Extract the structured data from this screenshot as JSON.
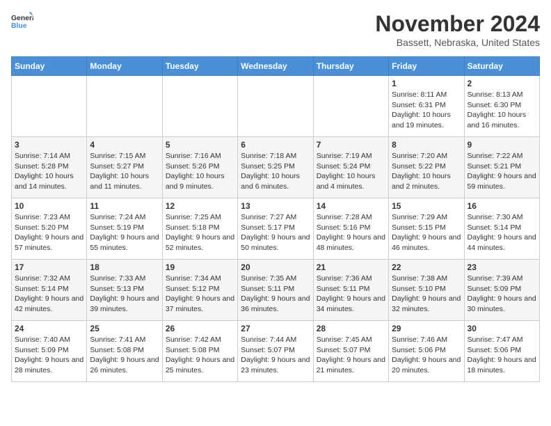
{
  "logo": {
    "text_general": "General",
    "text_blue": "Blue"
  },
  "header": {
    "month": "November 2024",
    "location": "Bassett, Nebraska, United States"
  },
  "weekdays": [
    "Sunday",
    "Monday",
    "Tuesday",
    "Wednesday",
    "Thursday",
    "Friday",
    "Saturday"
  ],
  "weeks": [
    [
      {
        "day": "",
        "info": ""
      },
      {
        "day": "",
        "info": ""
      },
      {
        "day": "",
        "info": ""
      },
      {
        "day": "",
        "info": ""
      },
      {
        "day": "",
        "info": ""
      },
      {
        "day": "1",
        "info": "Sunrise: 8:11 AM\nSunset: 6:31 PM\nDaylight: 10 hours and 19 minutes."
      },
      {
        "day": "2",
        "info": "Sunrise: 8:13 AM\nSunset: 6:30 PM\nDaylight: 10 hours and 16 minutes."
      }
    ],
    [
      {
        "day": "3",
        "info": "Sunrise: 7:14 AM\nSunset: 5:28 PM\nDaylight: 10 hours and 14 minutes."
      },
      {
        "day": "4",
        "info": "Sunrise: 7:15 AM\nSunset: 5:27 PM\nDaylight: 10 hours and 11 minutes."
      },
      {
        "day": "5",
        "info": "Sunrise: 7:16 AM\nSunset: 5:26 PM\nDaylight: 10 hours and 9 minutes."
      },
      {
        "day": "6",
        "info": "Sunrise: 7:18 AM\nSunset: 5:25 PM\nDaylight: 10 hours and 6 minutes."
      },
      {
        "day": "7",
        "info": "Sunrise: 7:19 AM\nSunset: 5:24 PM\nDaylight: 10 hours and 4 minutes."
      },
      {
        "day": "8",
        "info": "Sunrise: 7:20 AM\nSunset: 5:22 PM\nDaylight: 10 hours and 2 minutes."
      },
      {
        "day": "9",
        "info": "Sunrise: 7:22 AM\nSunset: 5:21 PM\nDaylight: 9 hours and 59 minutes."
      }
    ],
    [
      {
        "day": "10",
        "info": "Sunrise: 7:23 AM\nSunset: 5:20 PM\nDaylight: 9 hours and 57 minutes."
      },
      {
        "day": "11",
        "info": "Sunrise: 7:24 AM\nSunset: 5:19 PM\nDaylight: 9 hours and 55 minutes."
      },
      {
        "day": "12",
        "info": "Sunrise: 7:25 AM\nSunset: 5:18 PM\nDaylight: 9 hours and 52 minutes."
      },
      {
        "day": "13",
        "info": "Sunrise: 7:27 AM\nSunset: 5:17 PM\nDaylight: 9 hours and 50 minutes."
      },
      {
        "day": "14",
        "info": "Sunrise: 7:28 AM\nSunset: 5:16 PM\nDaylight: 9 hours and 48 minutes."
      },
      {
        "day": "15",
        "info": "Sunrise: 7:29 AM\nSunset: 5:15 PM\nDaylight: 9 hours and 46 minutes."
      },
      {
        "day": "16",
        "info": "Sunrise: 7:30 AM\nSunset: 5:14 PM\nDaylight: 9 hours and 44 minutes."
      }
    ],
    [
      {
        "day": "17",
        "info": "Sunrise: 7:32 AM\nSunset: 5:14 PM\nDaylight: 9 hours and 42 minutes."
      },
      {
        "day": "18",
        "info": "Sunrise: 7:33 AM\nSunset: 5:13 PM\nDaylight: 9 hours and 39 minutes."
      },
      {
        "day": "19",
        "info": "Sunrise: 7:34 AM\nSunset: 5:12 PM\nDaylight: 9 hours and 37 minutes."
      },
      {
        "day": "20",
        "info": "Sunrise: 7:35 AM\nSunset: 5:11 PM\nDaylight: 9 hours and 36 minutes."
      },
      {
        "day": "21",
        "info": "Sunrise: 7:36 AM\nSunset: 5:11 PM\nDaylight: 9 hours and 34 minutes."
      },
      {
        "day": "22",
        "info": "Sunrise: 7:38 AM\nSunset: 5:10 PM\nDaylight: 9 hours and 32 minutes."
      },
      {
        "day": "23",
        "info": "Sunrise: 7:39 AM\nSunset: 5:09 PM\nDaylight: 9 hours and 30 minutes."
      }
    ],
    [
      {
        "day": "24",
        "info": "Sunrise: 7:40 AM\nSunset: 5:09 PM\nDaylight: 9 hours and 28 minutes."
      },
      {
        "day": "25",
        "info": "Sunrise: 7:41 AM\nSunset: 5:08 PM\nDaylight: 9 hours and 26 minutes."
      },
      {
        "day": "26",
        "info": "Sunrise: 7:42 AM\nSunset: 5:08 PM\nDaylight: 9 hours and 25 minutes."
      },
      {
        "day": "27",
        "info": "Sunrise: 7:44 AM\nSunset: 5:07 PM\nDaylight: 9 hours and 23 minutes."
      },
      {
        "day": "28",
        "info": "Sunrise: 7:45 AM\nSunset: 5:07 PM\nDaylight: 9 hours and 21 minutes."
      },
      {
        "day": "29",
        "info": "Sunrise: 7:46 AM\nSunset: 5:06 PM\nDaylight: 9 hours and 20 minutes."
      },
      {
        "day": "30",
        "info": "Sunrise: 7:47 AM\nSunset: 5:06 PM\nDaylight: 9 hours and 18 minutes."
      }
    ]
  ]
}
